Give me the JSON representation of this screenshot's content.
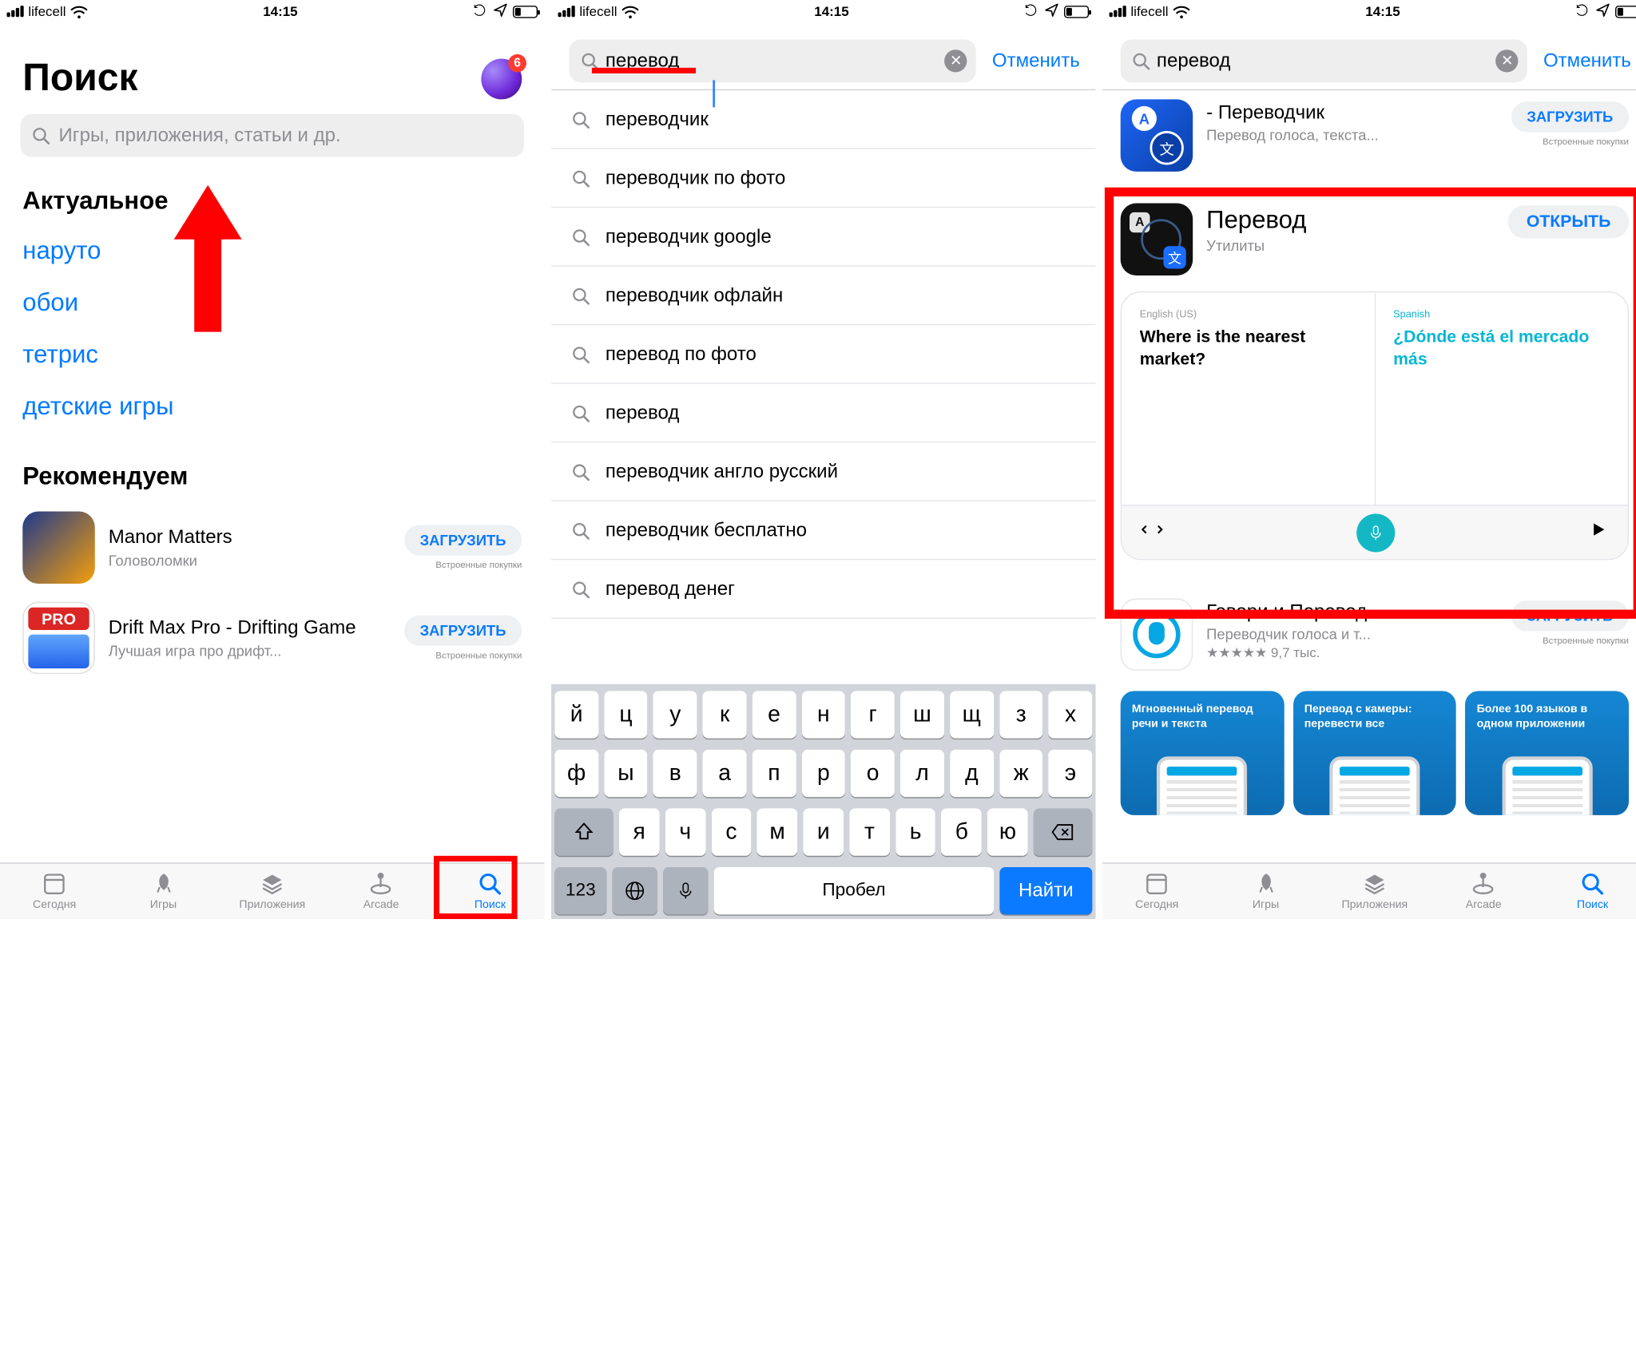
{
  "status": {
    "carrier": "lifecell",
    "time": "14:15"
  },
  "screen1": {
    "title": "Поиск",
    "badge": "6",
    "search_placeholder": "Игры, приложения, статьи и др.",
    "trending_header": "Актуальное",
    "trending": [
      "наруто",
      "обои",
      "тетрис",
      "детские игры"
    ],
    "recommend_header": "Рекомендуем",
    "apps": [
      {
        "name": "Manor Matters",
        "sub": "Головоломки",
        "btn": "ЗАГРУЗИТЬ",
        "iap": "Встроенные покупки"
      },
      {
        "name": "Drift Max Pro - Drifting Game",
        "sub": "Лучшая игра про дрифт...",
        "btn": "ЗАГРУЗИТЬ",
        "iap": "Встроенные покупки"
      }
    ],
    "tabs": {
      "today": "Сегодня",
      "games": "Игры",
      "apps": "Приложения",
      "arcade": "Arcade",
      "search": "Поиск"
    }
  },
  "screen2": {
    "query": "перевод",
    "cancel": "Отменить",
    "suggestions": [
      "переводчик",
      "переводчик по фото",
      "переводчик google",
      "переводчик офлайн",
      "перевод по фото",
      "перевод",
      "переводчик англо русский",
      "переводчик бесплатно",
      "перевод денег"
    ],
    "keyboard": {
      "row1": [
        "й",
        "ц",
        "у",
        "к",
        "е",
        "н",
        "г",
        "ш",
        "щ",
        "з",
        "х"
      ],
      "row2": [
        "ф",
        "ы",
        "в",
        "а",
        "п",
        "р",
        "о",
        "л",
        "д",
        "ж",
        "э"
      ],
      "row3": [
        "я",
        "ч",
        "с",
        "м",
        "и",
        "т",
        "ь",
        "б",
        "ю"
      ],
      "num": "123",
      "space": "Пробел",
      "go": "Найти"
    }
  },
  "screen3": {
    "query": "перевод",
    "cancel": "Отменить",
    "results": [
      {
        "title": "- Переводчик",
        "sub": "Перевод голоса, текста...",
        "btn": "ЗАГРУЗИТЬ",
        "iap": "Встроенные покупки"
      },
      {
        "title": "Перевод",
        "sub": "Утилиты",
        "btn": "ОТКРЫТЬ"
      },
      {
        "title": "Говори и Перевод...",
        "sub": "Переводчик голоса и т...",
        "rating": "★★★★★ 9,7 тыс.",
        "btn": "ЗАГРУЗИТЬ",
        "iap": "Встроенные покупки"
      }
    ],
    "shot": {
      "lang_en": "English (US)",
      "txt_en": "Where is the nearest market?",
      "lang_es": "Spanish",
      "txt_es": "¿Dónde está el mercado más"
    },
    "promos": [
      "Мгновенный перевод речи и текста",
      "Перевод с камеры: перевести все",
      "Более 100 языков в одном приложении"
    ],
    "tabs": {
      "today": "Сегодня",
      "games": "Игры",
      "apps": "Приложения",
      "arcade": "Arcade",
      "search": "Поиск"
    }
  }
}
